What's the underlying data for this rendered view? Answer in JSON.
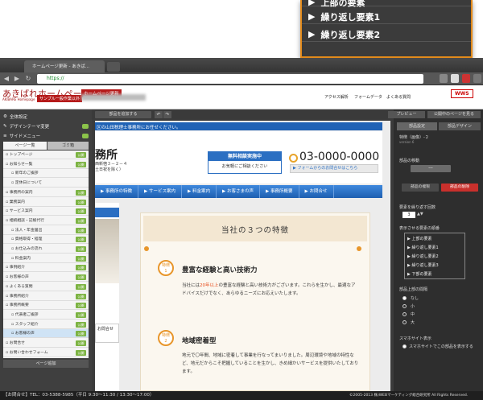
{
  "callout": {
    "items": [
      "上部の要素",
      "繰り返し要素1",
      "繰り返し要素2"
    ]
  },
  "browser": {
    "tab_title": "ホームページ更新 - あきば...",
    "url": "https://"
  },
  "site_header": {
    "logo": "あきばれホームページ",
    "logo_sub": "AKIBARE Homepage",
    "logo_badge": "サンプル一般作業以外",
    "update_badge": "ホームページ更新",
    "links": [
      "アクセス解析",
      "フォームデータ",
      "よくある質問"
    ],
    "brand": "WWS"
  },
  "sidebar": {
    "top_items": [
      {
        "label": "全体設定",
        "toggle": false
      },
      {
        "label": "デザインテーマ変更",
        "toggle": true
      },
      {
        "label": "サイドメニュー",
        "toggle": true
      }
    ],
    "tabs": [
      "ページ一覧",
      "ゴミ箱"
    ],
    "pages": [
      {
        "label": "トップページ",
        "badge": "公開",
        "active": false
      },
      {
        "label": "お知らせ一覧",
        "badge": "公開",
        "active": false
      },
      {
        "label": "新年のご挨拶",
        "badge": "",
        "active": false
      },
      {
        "label": "定休日について",
        "badge": "",
        "active": false
      },
      {
        "label": "事務所の案内",
        "badge": "公開",
        "active": false
      },
      {
        "label": "業務案内",
        "badge": "公開",
        "active": false
      },
      {
        "label": "サービス案内",
        "badge": "公開",
        "active": false
      },
      {
        "label": "相続相談・記帳代行",
        "badge": "公開",
        "active": false
      },
      {
        "label": "法人・年金届出",
        "badge": "公開",
        "active": false
      },
      {
        "label": "資格取得・経理",
        "badge": "公開",
        "active": false
      },
      {
        "label": "お仕込みの流れ",
        "badge": "公開",
        "active": false
      },
      {
        "label": "料金案内",
        "badge": "公開",
        "active": false
      },
      {
        "label": "事例紹介",
        "badge": "公開",
        "active": false
      },
      {
        "label": "お客様の声",
        "badge": "公開",
        "active": false
      },
      {
        "label": "よくある質問",
        "badge": "公開",
        "active": false
      },
      {
        "label": "事務所紹介",
        "badge": "公開",
        "active": false
      },
      {
        "label": "事務所概要",
        "badge": "公開",
        "active": false
      },
      {
        "label": "代表者ご挨拶",
        "badge": "公開",
        "active": false
      },
      {
        "label": "スタッフ紹介",
        "badge": "公開",
        "active": false
      },
      {
        "label": "お客様の声",
        "badge": "公開",
        "active": true
      },
      {
        "label": "お問合せ",
        "badge": "公開",
        "active": false
      },
      {
        "label": "お問い合わせフォーム",
        "badge": "公開",
        "active": false
      }
    ],
    "add_page": "ページ追加"
  },
  "editor": {
    "add_part": "部品を追加する",
    "notice": "区の山田税理士事務所にお任せください。",
    "office_name": "務所",
    "addr1": "西新宿３－２－４",
    "addr2": "土日祝を除く）",
    "consult_top": "無料相談実施中",
    "consult_bottom": "お気軽にご相談ください",
    "phone": "03-0000-0000",
    "contact_form": "フォームからのお問合せはこちら",
    "nav": [
      "事務所の特徴",
      "サービス案内",
      "料金案内",
      "お客さまの声",
      "事務所概要",
      "お問合せ"
    ],
    "left_inquiry": "お問合せ",
    "feature_title": "当社の３つの特徴",
    "features": [
      {
        "badge_top": "特徴",
        "badge_num": "1",
        "head": "豊富な経験と高い技術力",
        "text_pre": "当社には",
        "text_hl": "20年以上",
        "text_post": "の豊富な経験と高い技術力がございます。これらを生かし、最適なアドバイスだけでなく、あらゆるニーズにお応えいたします。"
      },
      {
        "badge_top": "特徴",
        "badge_num": "2",
        "head": "地域密着型",
        "text_pre": "",
        "text_hl": "",
        "text_post": "地元で〇年間、地域に密着して事業を行なってまいりました。周辺環境や地域の特性など、地元だからこそ把握していることを生かし、きめ細かいサービスを提供いたしております。"
      }
    ]
  },
  "right_panel": {
    "preview": "プレビュー",
    "publish": "公開中のページを見る",
    "tabs": [
      "部品設定",
      "部品デザイン"
    ],
    "part_type": "特徴（画像）-２",
    "version": "version 6",
    "move_label": "部品の移動",
    "move_select": "---",
    "duplicate": "部品の複製",
    "delete": "部品の削除",
    "repeat_label": "要素を繰り返す回数",
    "repeat_value": "3",
    "order_label": "表示させる要素の順番",
    "order_items": [
      "上部の要素",
      "繰り返し要素1",
      "繰り返し要素2",
      "繰り返し要素3",
      "下部の要素"
    ],
    "spacing_label": "部品上部の間隔",
    "spacing_options": [
      "なし",
      "小",
      "中",
      "大"
    ],
    "sp_label": "スマホサイト表示",
    "sp_option": "スマホサイトでこの部品を表示する"
  },
  "footer": {
    "left": "【お問合せ】TEL：03-5388-5985（平日 9:30～11:30 / 13:30～17:00）",
    "right": "©2005-2013 株)WEBマーケティング総合研究所 All Rights Reserved."
  }
}
